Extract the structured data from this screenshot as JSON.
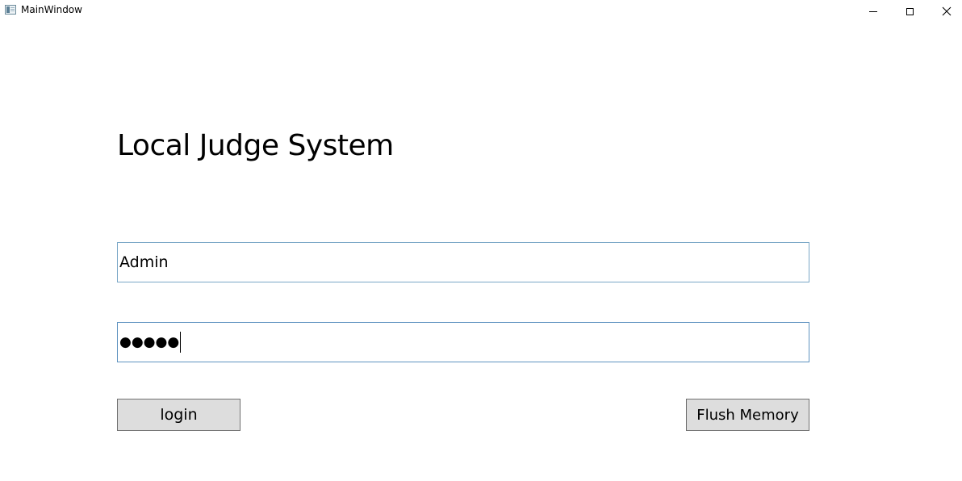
{
  "window": {
    "title": "MainWindow",
    "controls": {
      "minimize": "minimize-icon",
      "maximize": "maximize-icon",
      "close": "close-icon"
    }
  },
  "main": {
    "heading": "Local Judge System",
    "username_value": "Admin",
    "password_masked": "●●●●●",
    "login_label": "login",
    "flush_label": "Flush Memory"
  },
  "colors": {
    "background": "#ffffff",
    "input_border": "#7aa7c7",
    "button_background": "#dddddd",
    "button_border": "#707070"
  }
}
